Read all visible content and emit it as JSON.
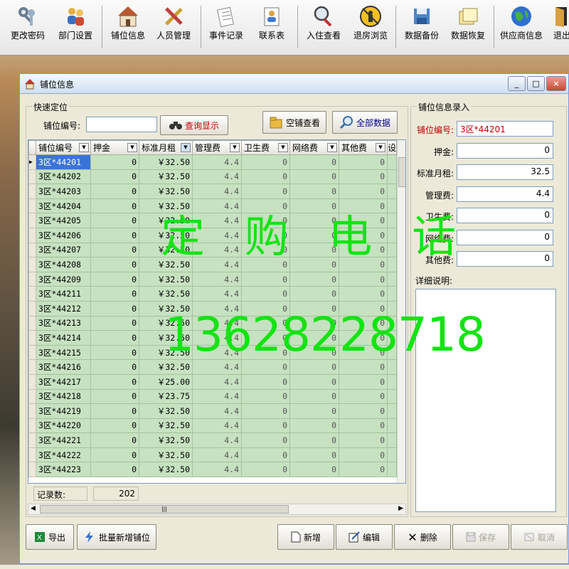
{
  "toolbar": {
    "items": [
      {
        "label": "更改密码",
        "icon": "keys-icon"
      },
      {
        "label": "部门设置",
        "icon": "people-icon"
      },
      {
        "label": "铺位信息",
        "icon": "house-icon"
      },
      {
        "label": "人员管理",
        "icon": "tools-icon"
      },
      {
        "label": "事件记录",
        "icon": "notes-icon"
      },
      {
        "label": "联系表",
        "icon": "contacts-icon"
      },
      {
        "label": "入住查看",
        "icon": "magnifier-icon"
      },
      {
        "label": "退房浏览",
        "icon": "no-entry-icon"
      },
      {
        "label": "数据备份",
        "icon": "backup-icon"
      },
      {
        "label": "数据恢复",
        "icon": "restore-icon"
      },
      {
        "label": "供应商信息",
        "icon": "globe-icon"
      },
      {
        "label": "退出",
        "icon": "exit-door-icon"
      }
    ]
  },
  "window": {
    "title": "铺位信息",
    "min": "_",
    "max": "□",
    "close": "×"
  },
  "quick": {
    "group_title": "快速定位",
    "field_label": "铺位编号:",
    "field_value": "",
    "query_btn": "查询显示",
    "empty_btn": "空铺查看",
    "all_btn": "全部数据"
  },
  "grid": {
    "columns": [
      "铺位编号",
      "押金",
      "标准月租",
      "管理费",
      "卫生费",
      "网络费",
      "其他费",
      "设"
    ],
    "rows": [
      [
        "3区*44201",
        "0",
        "￥32.50",
        "4.4",
        "0",
        "0",
        "0"
      ],
      [
        "3区*44202",
        "0",
        "￥32.50",
        "4.4",
        "0",
        "0",
        "0"
      ],
      [
        "3区*44203",
        "0",
        "￥32.50",
        "4.4",
        "0",
        "0",
        "0"
      ],
      [
        "3区*44204",
        "0",
        "￥32.50",
        "4.4",
        "0",
        "0",
        "0"
      ],
      [
        "3区*44205",
        "0",
        "￥32.50",
        "4.4",
        "0",
        "0",
        "0"
      ],
      [
        "3区*44206",
        "0",
        "￥32.50",
        "4.4",
        "0",
        "0",
        "0"
      ],
      [
        "3区*44207",
        "0",
        "￥32.50",
        "4.4",
        "0",
        "0",
        "0"
      ],
      [
        "3区*44208",
        "0",
        "￥32.50",
        "4.4",
        "0",
        "0",
        "0"
      ],
      [
        "3区*44209",
        "0",
        "￥32.50",
        "4.4",
        "0",
        "0",
        "0"
      ],
      [
        "3区*44211",
        "0",
        "￥32.50",
        "4.4",
        "0",
        "0",
        "0"
      ],
      [
        "3区*44212",
        "0",
        "￥32.50",
        "4.4",
        "0",
        "0",
        "0"
      ],
      [
        "3区*44213",
        "0",
        "￥32.50",
        "4.4",
        "0",
        "0",
        "0"
      ],
      [
        "3区*44214",
        "0",
        "￥32.50",
        "4.4",
        "0",
        "0",
        "0"
      ],
      [
        "3区*44215",
        "0",
        "￥32.50",
        "4.4",
        "0",
        "0",
        "0"
      ],
      [
        "3区*44216",
        "0",
        "￥32.50",
        "4.4",
        "0",
        "0",
        "0"
      ],
      [
        "3区*44217",
        "0",
        "￥25.00",
        "4.4",
        "0",
        "0",
        "0"
      ],
      [
        "3区*44218",
        "0",
        "￥23.75",
        "4.4",
        "0",
        "0",
        "0"
      ],
      [
        "3区*44219",
        "0",
        "￥32.50",
        "4.4",
        "0",
        "0",
        "0"
      ],
      [
        "3区*44220",
        "0",
        "￥32.50",
        "4.4",
        "0",
        "0",
        "0"
      ],
      [
        "3区*44221",
        "0",
        "￥32.50",
        "4.4",
        "0",
        "0",
        "0"
      ],
      [
        "3区*44222",
        "0",
        "￥32.50",
        "4.4",
        "0",
        "0",
        "0"
      ],
      [
        "3区*44223",
        "0",
        "￥32.50",
        "4.4",
        "0",
        "0",
        "0"
      ]
    ],
    "selected_row": 0,
    "record_label": "记录数:",
    "record_count": "202"
  },
  "form": {
    "group_title": "铺位信息录入",
    "fields": [
      {
        "label": "铺位编号:",
        "value": "3区*44201"
      },
      {
        "label": "押金:",
        "value": "0"
      },
      {
        "label": "标准月租:",
        "value": "32.5"
      },
      {
        "label": "管理费:",
        "value": "4.4"
      },
      {
        "label": "卫生费:",
        "value": "0"
      },
      {
        "label": "网络费:",
        "value": "0"
      },
      {
        "label": "其他费:",
        "value": "0"
      }
    ],
    "detail_label": "详细说明:",
    "detail_value": ""
  },
  "bottom": {
    "export": "导出",
    "batch_add": "批量新增铺位",
    "add": "新增",
    "edit": "编辑",
    "delete": "删除",
    "save": "保存",
    "cancel": "取消"
  },
  "watermark": {
    "line1": "定 购 电 话",
    "line2": "13628228718"
  },
  "colors": {
    "grid_row": "#c6e2c0",
    "selected": "#3b74d8",
    "watermark": "#12e412",
    "title_field": "#cc0000"
  }
}
